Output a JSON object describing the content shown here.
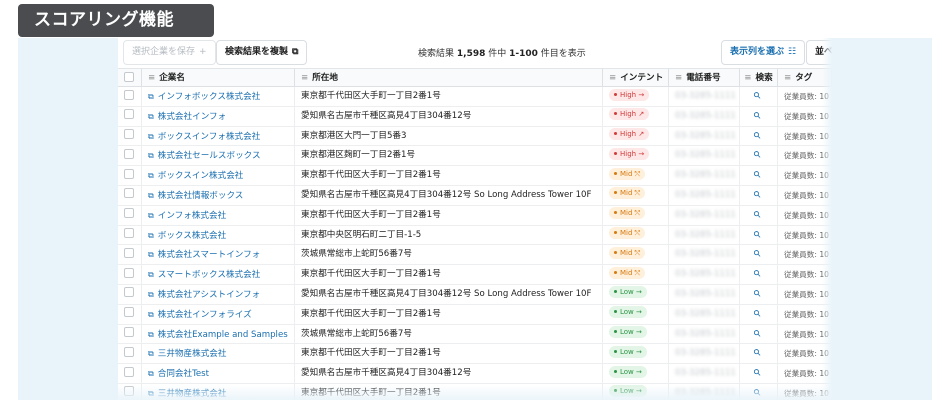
{
  "badge": "スコアリング機能",
  "toolbar": {
    "save_label": "選択企業を保存",
    "save_icon": "+",
    "copy_label": "検索結果を複製",
    "copy_icon": "⧉",
    "result_prefix": "検索結果",
    "result_total": "1,598",
    "result_mid": "件中",
    "result_range": "1-100",
    "result_suffix": "件目を表示",
    "columns_label": "表示列を選ぶ",
    "columns_icon": "☷",
    "sort_label": "並べ"
  },
  "headers": {
    "name": "企業名",
    "address": "所在地",
    "intent": "インテント",
    "phone": "電話番号",
    "search": "検索",
    "tag": "タグ"
  },
  "rows": [
    {
      "name": "インフォボックス株式会社",
      "address": "東京都千代田区大手町一丁目2番1号",
      "intent": "High",
      "level": "high",
      "arrow": "→",
      "phone": "03-3285-1111",
      "tag": "従業員数: 10"
    },
    {
      "name": "株式会社インフォ",
      "address": "愛知県名古屋市千種区高見4丁目304番12号",
      "intent": "High",
      "level": "high",
      "arrow": "↗",
      "phone": "03-3285-1111",
      "tag": "従業員数: 10"
    },
    {
      "name": "ボックスインフォ株式会社",
      "address": "東京都港区大門一丁目5番3",
      "intent": "High",
      "level": "high",
      "arrow": "↗",
      "phone": "03-3285-1111",
      "tag": "従業員数: 10"
    },
    {
      "name": "株式会社セールスボックス",
      "address": "東京都港区麹町一丁目2番1号",
      "intent": "High",
      "level": "high",
      "arrow": "→",
      "phone": "03-3285-1111",
      "tag": "従業員数: 10"
    },
    {
      "name": "ボックスイン株式会社",
      "address": "東京都千代田区大手町一丁目2番1号",
      "intent": "Mid",
      "level": "mid",
      "arrow": "⤲",
      "phone": "03-3285-1111",
      "tag": "従業員数: 10"
    },
    {
      "name": "株式会社情報ボックス",
      "address": "愛知県名古屋市千種区高見4丁目304番12号 So Long Address Tower 10F",
      "intent": "Mid",
      "level": "mid",
      "arrow": "⤲",
      "phone": "03-3285-1111",
      "tag": "従業員数: 10"
    },
    {
      "name": "インフォ株式会社",
      "address": "東京都千代田区大手町一丁目2番1号",
      "intent": "Mid",
      "level": "mid",
      "arrow": "⤲",
      "phone": "03-3285-1111",
      "tag": "従業員数: 10"
    },
    {
      "name": "ボックス株式会社",
      "address": "東京都中央区明石町二丁目-1-5",
      "intent": "Mid",
      "level": "mid",
      "arrow": "⤲",
      "phone": "03-3285-1111",
      "tag": "従業員数: 10"
    },
    {
      "name": "株式会社スマートインフォ",
      "address": "茨城県常総市上蛇町56番7号",
      "intent": "Mid",
      "level": "mid",
      "arrow": "⤲",
      "phone": "03-3285-1111",
      "tag": "従業員数: 10"
    },
    {
      "name": "スマートボックス株式会社",
      "address": "東京都千代田区大手町一丁目2番1号",
      "intent": "Mid",
      "level": "mid",
      "arrow": "⤲",
      "phone": "03-3285-1111",
      "tag": "従業員数: 10"
    },
    {
      "name": "株式会社アシストインフォ",
      "address": "愛知県名古屋市千種区高見4丁目304番12号 So Long Address Tower 10F",
      "intent": "Low",
      "level": "low",
      "arrow": "→",
      "phone": "03-3285-1111",
      "tag": "従業員数: 10"
    },
    {
      "name": "株式会社インフォライズ",
      "address": "東京都千代田区大手町一丁目2番1号",
      "intent": "Low",
      "level": "low",
      "arrow": "→",
      "phone": "03-3285-1111",
      "tag": "従業員数: 10"
    },
    {
      "name": "株式会社Example and Samples",
      "address": "茨城県常総市上蛇町56番7号",
      "intent": "Low",
      "level": "low",
      "arrow": "→",
      "phone": "03-3285-1111",
      "tag": "従業員数: 10"
    },
    {
      "name": "三井物産株式会社",
      "address": "東京都千代田区大手町一丁目2番1号",
      "intent": "Low",
      "level": "low",
      "arrow": "→",
      "phone": "03-3285-1111",
      "tag": "従業員数: 10"
    },
    {
      "name": "合同会社Test",
      "address": "愛知県名古屋市千種区高見4丁目304番12号",
      "intent": "Low",
      "level": "low",
      "arrow": "→",
      "phone": "03-3285-1111",
      "tag": "従業員数: 10"
    },
    {
      "name": "三井物産株式会社",
      "address": "東京都千代田区大手町一丁目2番1号",
      "intent": "Low",
      "level": "low",
      "arrow": "→",
      "phone": "03-3285-1111",
      "tag": "従業員数: 10"
    }
  ],
  "colors": {
    "link": "#1a6fb0",
    "high": "#d23b3b",
    "mid": "#d77a10",
    "low": "#2c9447",
    "panel_bg": "#e9f4fa",
    "badge_bg": "#4a4c4f"
  }
}
